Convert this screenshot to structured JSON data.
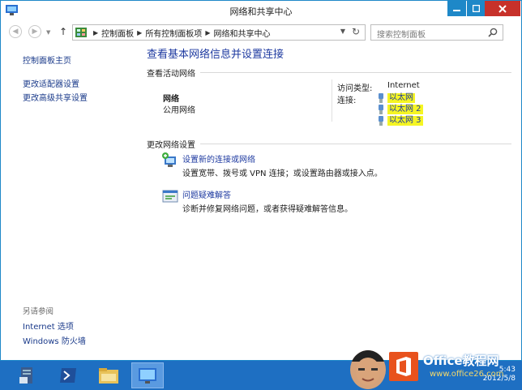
{
  "window": {
    "title": "网络和共享中心",
    "accent_color": "#1e88c8",
    "close_color": "#c7312a"
  },
  "navigation": {
    "breadcrumbs": [
      "控制面板",
      "所有控制面板项",
      "网络和共享中心"
    ],
    "search_placeholder": "搜索控制面板"
  },
  "sidebar": {
    "links": [
      "控制面板主页",
      "更改适配器设置",
      "更改高级共享设置"
    ],
    "see_also_heading": "另请参阅",
    "see_also_links": [
      "Internet 选项",
      "Windows 防火墙"
    ]
  },
  "main": {
    "title": "查看基本网络信息并设置连接",
    "active_networks_heading": "查看活动网络",
    "network": {
      "name": "网络",
      "type": "公用网络",
      "access_type_label": "访问类型:",
      "access_type_value": "Internet",
      "connections_label": "连接:",
      "connections": [
        "以太网",
        "以太网 2",
        "以太网 3"
      ]
    },
    "change_settings_heading": "更改网络设置",
    "tasks": [
      {
        "link": "设置新的连接或网络",
        "description": "设置宽带、拨号或 VPN 连接；或设置路由器或接入点。",
        "icon": "new-connection-icon"
      },
      {
        "link": "问题疑难解答",
        "description": "诊断并修复网络问题，或者获得疑难解答信息。",
        "icon": "troubleshoot-icon"
      }
    ]
  },
  "taskbar": {
    "items": [
      "server-manager-icon",
      "powershell-icon",
      "file-explorer-icon",
      "control-panel-icon"
    ],
    "clock": {
      "time": "5:43",
      "date": "2012/5/8"
    }
  },
  "watermark": {
    "brand": "Office教程网",
    "url": "www.office26.com"
  }
}
